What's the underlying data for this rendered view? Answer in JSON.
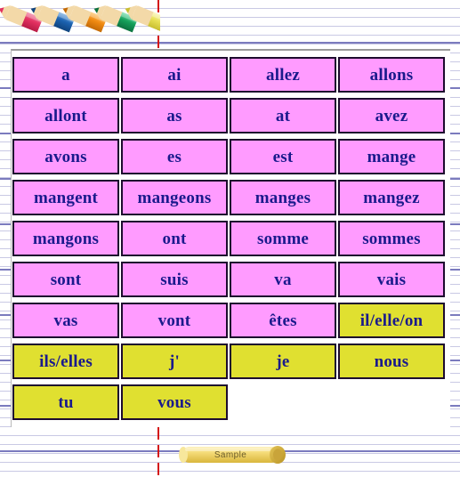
{
  "page": {
    "title": "French Verb Word Grid",
    "background": "lined-notebook-paper",
    "margin_rule_color": "#d41414",
    "line_color": "#c9c9e4",
    "bold_line_color": "#7b7bbe"
  },
  "decorations": {
    "pencils": [
      {
        "name": "pencil-red",
        "color": "#e23060",
        "body_light": "#f07a9c"
      },
      {
        "name": "pencil-blue",
        "color": "#1c62b0",
        "body_light": "#5a9bdc"
      },
      {
        "name": "pencil-orange",
        "color": "#f08a12",
        "body_light": "#ffb74d"
      },
      {
        "name": "pencil-green",
        "color": "#15a05a",
        "body_light": "#5fd39b"
      },
      {
        "name": "pencil-yellow",
        "color": "#e8e055",
        "body_light": "#f7f29a"
      }
    ],
    "wood_color": "#f3d9a8",
    "sample": {
      "label": "Sample",
      "scroll_color": "#f2d25c",
      "text_color": "#6b5c2a"
    }
  },
  "grid": {
    "columns": 4,
    "colors": {
      "pink": "#ff9bff",
      "yellow": "#e0e030",
      "border": "#1d0b2e",
      "text": "#1a1a8c"
    },
    "rows": [
      [
        {
          "text": "a",
          "color": "pink"
        },
        {
          "text": "ai",
          "color": "pink"
        },
        {
          "text": "allez",
          "color": "pink"
        },
        {
          "text": "allons",
          "color": "pink"
        }
      ],
      [
        {
          "text": "allont",
          "color": "pink"
        },
        {
          "text": "as",
          "color": "pink"
        },
        {
          "text": "at",
          "color": "pink"
        },
        {
          "text": "avez",
          "color": "pink"
        }
      ],
      [
        {
          "text": "avons",
          "color": "pink"
        },
        {
          "text": "es",
          "color": "pink"
        },
        {
          "text": "est",
          "color": "pink"
        },
        {
          "text": "mange",
          "color": "pink"
        }
      ],
      [
        {
          "text": "mangent",
          "color": "pink"
        },
        {
          "text": "mangeons",
          "color": "pink"
        },
        {
          "text": "manges",
          "color": "pink"
        },
        {
          "text": "mangez",
          "color": "pink"
        }
      ],
      [
        {
          "text": "mangons",
          "color": "pink"
        },
        {
          "text": "ont",
          "color": "pink"
        },
        {
          "text": "somme",
          "color": "pink"
        },
        {
          "text": "sommes",
          "color": "pink"
        }
      ],
      [
        {
          "text": "sont",
          "color": "pink"
        },
        {
          "text": "suis",
          "color": "pink"
        },
        {
          "text": "va",
          "color": "pink"
        },
        {
          "text": "vais",
          "color": "pink"
        }
      ],
      [
        {
          "text": "vas",
          "color": "pink"
        },
        {
          "text": "vont",
          "color": "pink"
        },
        {
          "text": "êtes",
          "color": "pink"
        },
        {
          "text": "il/elle/on",
          "color": "yellow"
        }
      ],
      [
        {
          "text": "ils/elles",
          "color": "yellow"
        },
        {
          "text": "j'",
          "color": "yellow"
        },
        {
          "text": "je",
          "color": "yellow"
        },
        {
          "text": "nous",
          "color": "yellow"
        }
      ],
      [
        {
          "text": "tu",
          "color": "yellow"
        },
        {
          "text": "vous",
          "color": "yellow"
        },
        {
          "text": "",
          "color": "empty"
        },
        {
          "text": "",
          "color": "empty"
        }
      ]
    ]
  }
}
